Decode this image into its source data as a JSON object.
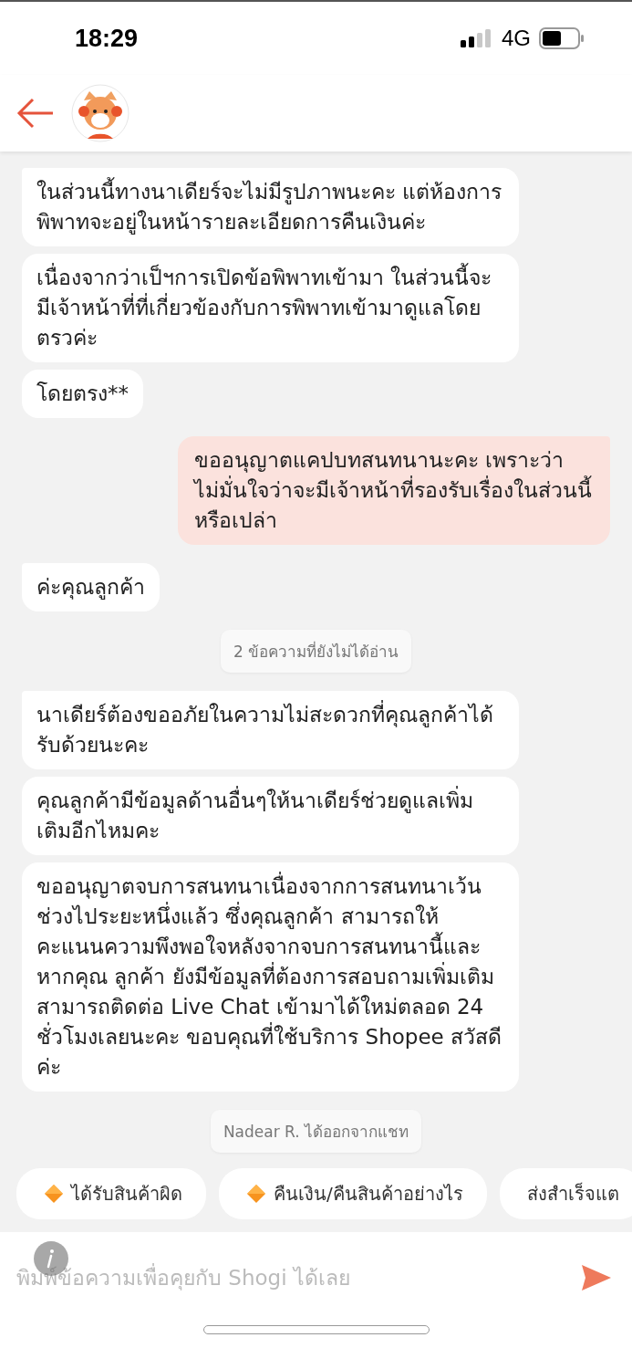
{
  "status_bar": {
    "time": "18:29",
    "network": "4G"
  },
  "messages": [
    {
      "kind": "received",
      "tail": true,
      "text": "ในส่วนนี้ทางนาเดียร์จะไม่มีรูปภาพนะคะ  แต่ห้องการพิพาทจะอยู่ในหน้ารายละเอียดการคืนเงินค่ะ"
    },
    {
      "kind": "received",
      "tail": false,
      "text": "เนื่องจากว่าเป็ฯการเปิดข้อพิพาทเข้ามา ในส่วนนี้จะมีเจ้าหน้าที่ที่เกี่ยวข้องกับการพิพาทเข้ามาดูแลโดยตรวค่ะ"
    },
    {
      "kind": "received",
      "tail": false,
      "text": "โดยตรง**"
    },
    {
      "kind": "sent",
      "tail": true,
      "text": "ขออนุญาตแคปบทสนทนานะคะ เพราะว่า ไม่มั่นใจว่าจะมีเจ้าหน้าที่รองรับเรื่องในส่วนนี้หรือเปล่า"
    },
    {
      "kind": "received",
      "tail": true,
      "text": "ค่ะคุณลูกค้า"
    },
    {
      "kind": "system",
      "text": "2 ข้อความที่ยังไม่ได้อ่าน"
    },
    {
      "kind": "received",
      "tail": true,
      "text": "นาเดียร์ต้องขออภัยในความไม่สะดวกที่คุณลูกค้าได้รับด้วยนะคะ"
    },
    {
      "kind": "received",
      "tail": false,
      "text": "คุณลูกค้ามีข้อมูลด้านอื่นๆให้นาเดียร์ช่วยดูแลเพิ่มเติมอีกไหมคะ"
    },
    {
      "kind": "received",
      "tail": false,
      "text": "ขออนุญาตจบการสนทนาเนื่องจากการสนทนาเว้นช่วงไประยะหนึ่งแล้ว ซึ่งคุณลูกค้า สามารถให้คะแนนความพึงพอใจหลังจากจบการสนทนานี้และหากคุณ ลูกค้า ยังมีข้อมูลที่ต้องการสอบถามเพิ่มเติมสามารถติดต่อ Live Chat เข้ามาได้ใหม่ตลอด 24 ชั่วโมงเลยนะคะ ขอบคุณที่ใช้บริการ Shopee สวัสดีค่ะ"
    },
    {
      "kind": "system",
      "text": "Nadear R. ได้ออกจากแชท"
    }
  ],
  "quick_replies": [
    {
      "label": "ได้รับสินค้าผิด",
      "icon": true
    },
    {
      "label": "คืนเงิน/คืนสินค้าอย่างไร",
      "icon": true
    },
    {
      "label": "ส่งสำเร็จแต",
      "icon": false
    }
  ],
  "input": {
    "placeholder": "พิมพ์ข้อความเพื่อคุยกับ Shogi ได้เลย"
  }
}
